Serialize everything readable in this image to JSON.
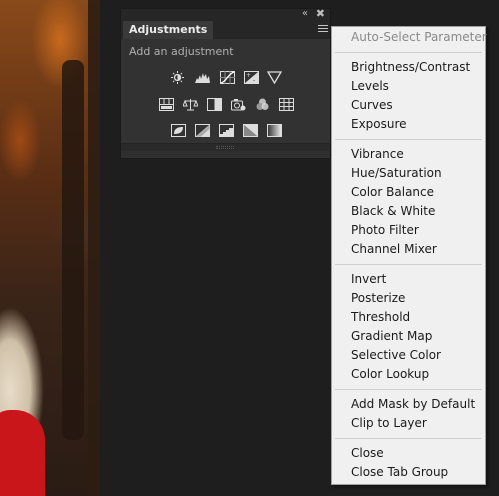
{
  "panel": {
    "title": "Adjustments",
    "subtitle": "Add an adjustment",
    "row1": [
      "brightness-contrast-icon",
      "levels-icon",
      "curves-icon",
      "exposure-icon",
      "vibrance-icon"
    ],
    "row2": [
      "hue-saturation-icon",
      "color-balance-icon",
      "black-white-icon",
      "photo-filter-icon",
      "channel-mixer-icon",
      "color-lookup-icon"
    ],
    "row3": [
      "invert-icon",
      "posterize-icon",
      "threshold-icon",
      "gradient-map-icon",
      "selective-color-icon"
    ]
  },
  "menu": {
    "auto_select": "Auto-Select Parameter",
    "group1": [
      "Brightness/Contrast",
      "Levels",
      "Curves",
      "Exposure"
    ],
    "group2": [
      "Vibrance",
      "Hue/Saturation",
      "Color Balance",
      "Black & White",
      "Photo Filter",
      "Channel Mixer"
    ],
    "group3": [
      "Invert",
      "Posterize",
      "Threshold",
      "Gradient Map",
      "Selective Color",
      "Color Lookup"
    ],
    "group4": [
      "Add Mask by Default",
      "Clip to Layer"
    ],
    "group5": [
      "Close",
      "Close Tab Group"
    ]
  }
}
